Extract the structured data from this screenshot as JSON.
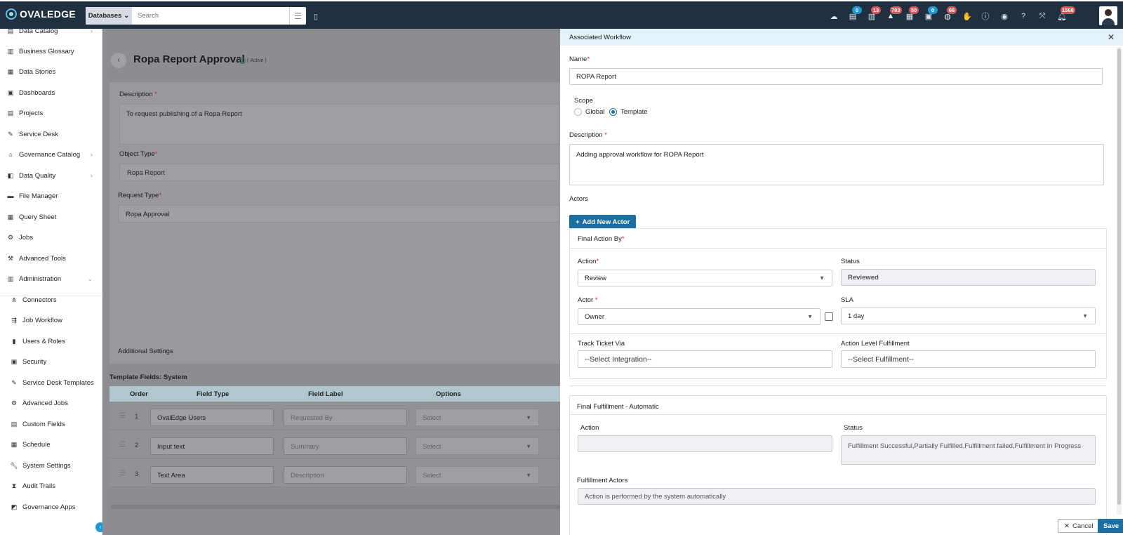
{
  "topbar": {
    "logo": "OVALEDGE",
    "search_scope": "Databases",
    "search_placeholder": "Search",
    "badges": {
      "b1": "0",
      "b2": "13",
      "b3": "783",
      "b4": "50",
      "b5": "0",
      "b6": "66",
      "b7": "1568"
    }
  },
  "sidebar": {
    "items": [
      {
        "label": "Data Catalog"
      },
      {
        "label": "Business Glossary"
      },
      {
        "label": "Data Stories"
      },
      {
        "label": "Dashboards"
      },
      {
        "label": "Projects"
      },
      {
        "label": "Service Desk"
      },
      {
        "label": "Governance Catalog"
      },
      {
        "label": "Data Quality"
      },
      {
        "label": "File Manager"
      },
      {
        "label": "Query Sheet"
      },
      {
        "label": "Jobs"
      },
      {
        "label": "Advanced Tools"
      },
      {
        "label": "Administration"
      }
    ],
    "admin_items": [
      {
        "label": "Connectors"
      },
      {
        "label": "Job Workflow"
      },
      {
        "label": "Users & Roles"
      },
      {
        "label": "Security"
      },
      {
        "label": "Service Desk Templates"
      },
      {
        "label": "Advanced Jobs"
      },
      {
        "label": "Custom Fields"
      },
      {
        "label": "Schedule"
      },
      {
        "label": "System Settings"
      },
      {
        "label": "Audit Trails"
      },
      {
        "label": "Governance Apps"
      }
    ]
  },
  "main": {
    "title": "Ropa Report Approval",
    "status": "Active",
    "description_label": "Description",
    "description_value": "To request publishing of a Ropa Report",
    "object_type_label": "Object Type",
    "object_type_value": "Ropa Report",
    "request_type_label": "Request Type",
    "request_type_value": "Ropa Approval",
    "additional_settings": "Additional Settings",
    "template_title": "Template Fields: System",
    "columns": [
      "Order",
      "Field Type",
      "Field Label",
      "Options"
    ],
    "rows": [
      {
        "order": "1",
        "type": "OvalEdge Users",
        "label": "Requested By",
        "option": "Select"
      },
      {
        "order": "2",
        "type": "Input text",
        "label": "Summary",
        "option": "Select"
      },
      {
        "order": "3",
        "type": "Text Area",
        "label": "Description",
        "option": "Select"
      }
    ]
  },
  "panel": {
    "title": "Associated Workflow",
    "name_label": "Name",
    "name_value": "ROPA Report",
    "scope_label": "Scope",
    "scope_global": "Global",
    "scope_template": "Template",
    "description_label": "Description",
    "description_value": "Adding approval workflow for ROPA Report",
    "actors_label": "Actors",
    "add_actor": "Add New Actor",
    "final_action": {
      "title": "Final Action By",
      "action_label": "Action",
      "action_value": "Review",
      "status_label": "Status",
      "status_value": "Reviewed",
      "actor_label": "Actor",
      "actor_value": "Owner",
      "sla_label": "SLA",
      "sla_value": "1 day",
      "track_label": "Track Ticket Via",
      "track_placeholder": "--Select Integration--",
      "fulfill_label": "Action Level Fulfillment",
      "fulfill_placeholder": "--Select Fulfillment--"
    },
    "final_fulfillment": {
      "title": "Final Fulfillment - Automatic",
      "action_label": "Action",
      "status_label": "Status",
      "status_value": "Fulfillment Successful,Partially Fulfilled,Fulfillment failed,Fulfillment In Progress",
      "actors_label": "Fulfillment Actors",
      "actors_value": "Action is performed by the system automatically"
    },
    "cancel": "Cancel",
    "save": "Save"
  }
}
